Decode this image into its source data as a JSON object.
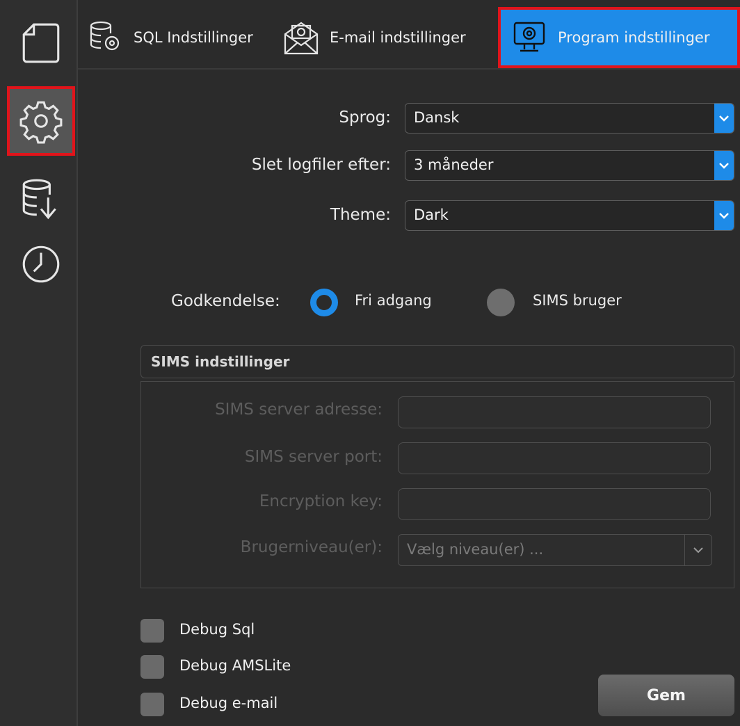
{
  "rail": {
    "items": [
      {
        "icon": "document-icon"
      },
      {
        "icon": "gear-icon",
        "active": true
      },
      {
        "icon": "database-download-icon"
      },
      {
        "icon": "clock-icon"
      }
    ]
  },
  "tabs": [
    {
      "label": "SQL Indstillinger",
      "icon": "database-gear-icon"
    },
    {
      "label": "E-mail indstillinger",
      "icon": "envelope-gear-icon"
    },
    {
      "label": "Program indstillinger",
      "icon": "monitor-gear-icon",
      "active": true
    }
  ],
  "form": {
    "language_label": "Sprog:",
    "language_value": "Dansk",
    "logfiles_label": "Slet logfiler efter:",
    "logfiles_value": "3 måneder",
    "theme_label": "Theme:",
    "theme_value": "Dark",
    "auth_label": "Godkendelse:",
    "auth_option_free": "Fri adgang",
    "auth_option_sims": "SIMS bruger",
    "auth_selected": "Fri adgang"
  },
  "sims": {
    "title": "SIMS indstillinger",
    "server_address_label": "SIMS server adresse:",
    "server_port_label": "SIMS server port:",
    "encryption_key_label": "Encryption key:",
    "user_level_label": "Brugerniveau(er):",
    "user_level_placeholder": "Vælg niveau(er) ..."
  },
  "debug": {
    "sql": "Debug Sql",
    "amslite": "Debug AMSLite",
    "email": "Debug e-mail"
  },
  "save_label": "Gem",
  "colors": {
    "accent": "#1e8be8",
    "highlight": "#e0141b"
  }
}
